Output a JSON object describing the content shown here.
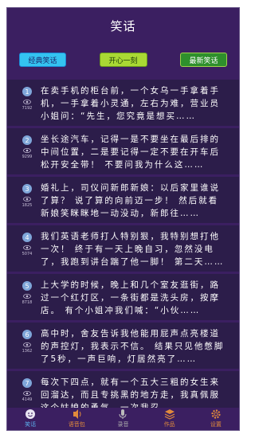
{
  "header": {
    "title": "笑话"
  },
  "tabs": [
    {
      "label": "经典笑话"
    },
    {
      "label": "开心一刻"
    },
    {
      "label": "最新笑话"
    }
  ],
  "jokes": [
    {
      "num": "1",
      "views": "7192",
      "text": "在卖手机的柜台前，一个女乌一手拿着手机，一手拿着小灵通，左右为难，营业员小姐问：“先生，您究竟是想买……"
    },
    {
      "num": "2",
      "views": "9299",
      "text": "坐长途汽车，记得一是不要坐在最后排的中间位置，二是要记得一定不要在开车后松开安全带！ 不要问我为什么这……"
    },
    {
      "num": "3",
      "views": "1825",
      "text": "婚礼上，司仪问新郎新娘：以后家里谁说了算？ 说了算的向前迈一步！ 然后就看新娘笑眯眯地一动没动，新郎往……"
    },
    {
      "num": "4",
      "views": "5074",
      "text": "我们英语老师打人特别狠，我特别想打他一次！ 终于有一天上晚自习，忽然没电了，我跑到讲台踹了他一脚！ 第二天……"
    },
    {
      "num": "5",
      "views": "8718",
      "text": "上大学的时候，晚上和几个室友逛街，路过一个红灯区，一条街都是洗头房，按摩店。 有个小姐冲我们喊：“小伙……"
    },
    {
      "num": "6",
      "views": "1362",
      "text": "高中时，舍友告诉我他能用屁声点亮楼道的声控灯，我表示不信。 结果只见他憋脚了5秒，一声巨响，灯居然亮了……"
    },
    {
      "num": "7",
      "views": "4149",
      "text": "每次下四点，就有一个五大三粗的女生来回溜达，而且专挑黑的地方走，我真佩服这个姑娘的勇气，一次我忍……"
    }
  ],
  "tabbar": [
    {
      "label": "笑话",
      "icon": "smile-icon"
    },
    {
      "label": "语音包",
      "icon": "audio-icon"
    },
    {
      "label": "录音",
      "icon": "mic-icon"
    },
    {
      "label": "作品",
      "icon": "layers-icon"
    },
    {
      "label": "设置",
      "icon": "gear-icon"
    }
  ]
}
